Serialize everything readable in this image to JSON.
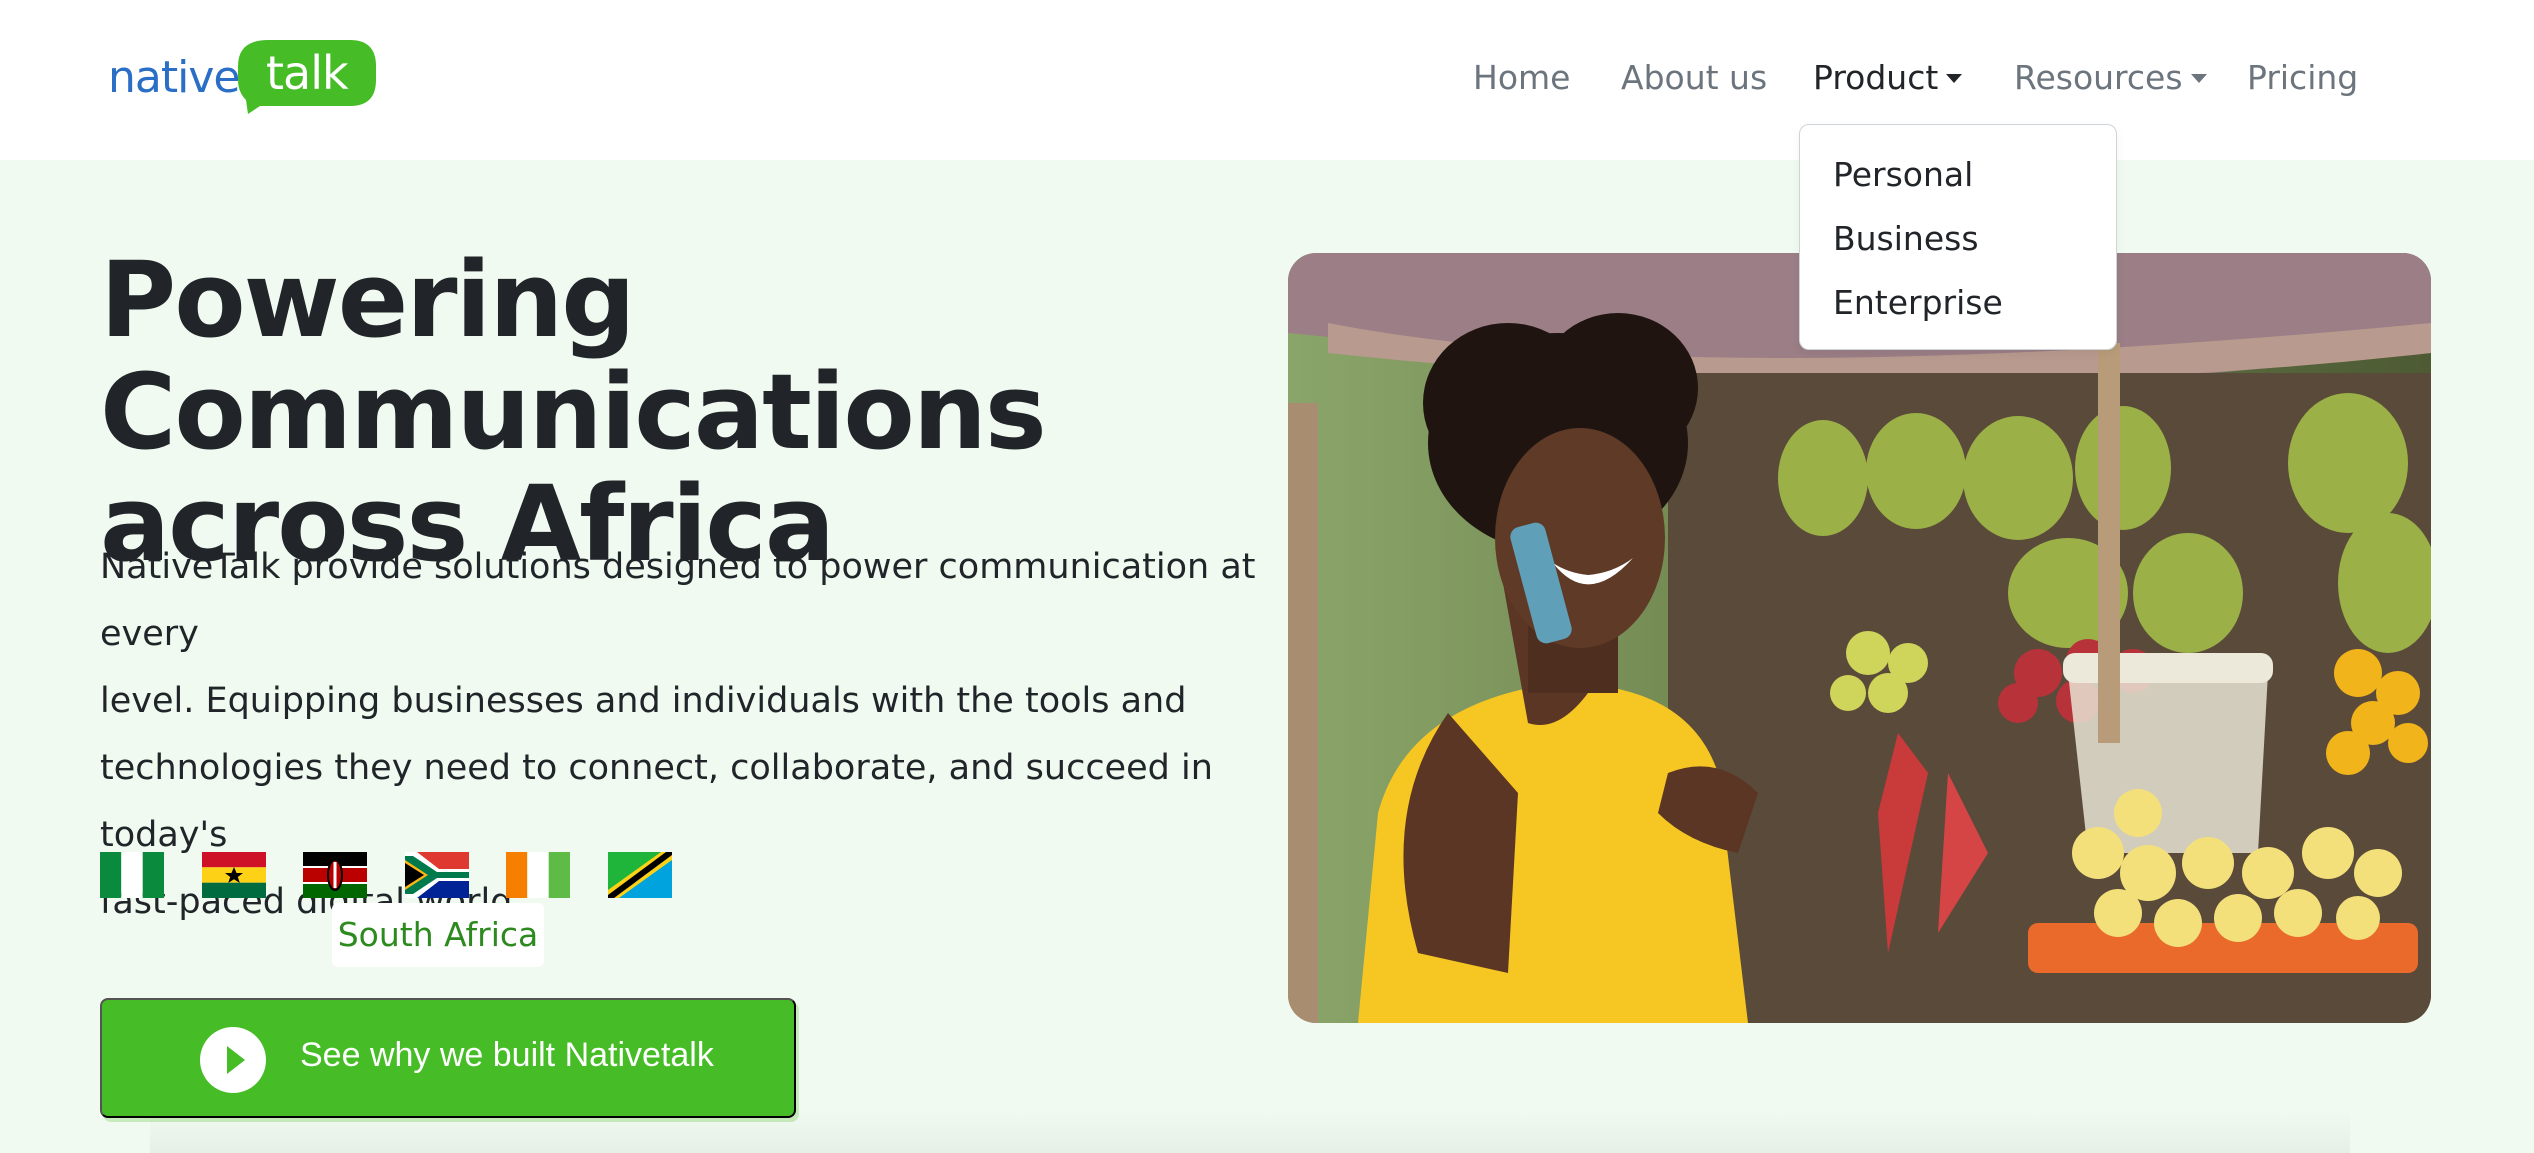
{
  "logo": {
    "left_text": "native",
    "right_text": "talk",
    "colors": {
      "blue": "#2a6ec6",
      "green": "#46bd26"
    }
  },
  "nav": {
    "items": [
      {
        "label": "Home"
      },
      {
        "label": "About us"
      },
      {
        "label": "Product",
        "active": true,
        "dropdown": true
      },
      {
        "label": "Resources",
        "dropdown": true
      },
      {
        "label": "Pricing"
      }
    ]
  },
  "product_dropdown": {
    "items": [
      "Personal",
      "Business",
      "Enterprise"
    ]
  },
  "hero": {
    "title_line1": "Powering Communications",
    "title_line2": "across Africa",
    "desc_line1": "NativeTalk provide solutions designed to power communication at every",
    "desc_line2": "level. Equipping businesses and individuals with the tools and",
    "desc_line3": "technologies they need to connect, collaborate, and succeed in today's",
    "desc_line4": "fast-paced digital world."
  },
  "flags": [
    "nigeria-flag-icon",
    "ghana-flag-icon",
    "kenya-flag-icon",
    "south-africa-flag-icon",
    "ivory-coast-flag-icon",
    "tanzania-flag-icon"
  ],
  "flag_tooltip": "South Africa",
  "cta": {
    "label": "See why we built Nativetalk",
    "icon": "play-icon",
    "color": "#46bd26"
  }
}
